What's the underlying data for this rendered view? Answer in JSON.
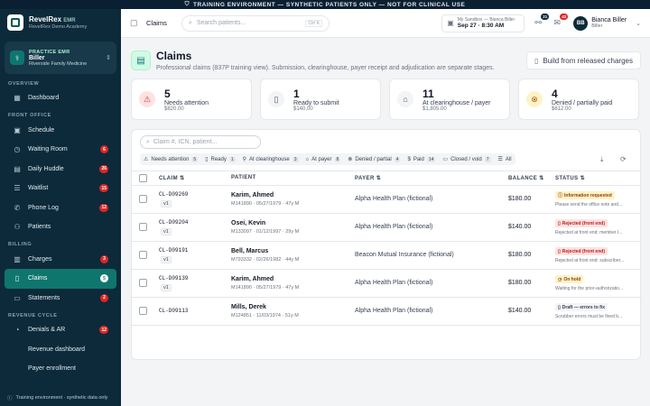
{
  "banner": {
    "icon": "shield-icon",
    "text": "TRAINING ENVIRONMENT — SYNTHETIC PATIENTS ONLY — NOT FOR CLINICAL USE"
  },
  "brand": {
    "name": "RevelRex",
    "suffix": "EMR",
    "subtitle": "RevelRex Demo Academy"
  },
  "practice": {
    "label": "PRACTICE EMR",
    "user": "Biller",
    "location": "Riverside Family Medicine"
  },
  "sidebar": {
    "sections": [
      {
        "title": "OVERVIEW",
        "items": [
          {
            "label": "Dashboard",
            "icon": "grid-icon",
            "badge": ""
          }
        ]
      },
      {
        "title": "FRONT OFFICE",
        "items": [
          {
            "label": "Schedule",
            "icon": "calendar-icon",
            "badge": ""
          },
          {
            "label": "Waiting Room",
            "icon": "clock-icon",
            "badge": "6"
          },
          {
            "label": "Daily Huddle",
            "icon": "clipboard-icon",
            "badge": "26"
          },
          {
            "label": "Waitlist",
            "icon": "list-icon",
            "badge": "15"
          },
          {
            "label": "Phone Log",
            "icon": "phone-icon",
            "badge": "12"
          },
          {
            "label": "Patients",
            "icon": "users-icon",
            "badge": ""
          }
        ]
      },
      {
        "title": "BILLING",
        "items": [
          {
            "label": "Charges",
            "icon": "receipt-icon",
            "badge": "3"
          },
          {
            "label": "Claims",
            "icon": "document-icon",
            "badge": "5",
            "active": true
          },
          {
            "label": "Statements",
            "icon": "file-icon",
            "badge": "2"
          }
        ]
      },
      {
        "title": "REVENUE CYCLE",
        "items": [
          {
            "label": "Denials & AR",
            "icon": "alert-icon",
            "badge": "12"
          },
          {
            "label": "Revenue dashboard",
            "icon": "",
            "badge": ""
          },
          {
            "label": "Payer enrollment",
            "icon": "",
            "badge": ""
          }
        ]
      }
    ],
    "footer": "Training environment · synthetic data only"
  },
  "topbar": {
    "breadcrumb": "Claims",
    "search_placeholder": "Search patients...",
    "search_shortcut": "Ctrl K",
    "sandbox_label": "My Sandbox — Bianca Biller",
    "sandbox_date": "Sep 27 · 8:30 AM",
    "tasks_count": "21",
    "messages_count": "42",
    "user_initials": "BB",
    "user_name": "Bianca Biller",
    "user_role": "Biller"
  },
  "page": {
    "title": "Claims",
    "subtitle": "Professional claims (837P training view). Submission, clearinghouse, payer receipt and adjudication are separate stages.",
    "build_button": "Build from released charges"
  },
  "stats": [
    {
      "value": "5",
      "label": "Needs attention",
      "amount": "$820.00",
      "icon": "warning-icon",
      "bg": "#fee2e2",
      "fg": "#dc2626"
    },
    {
      "value": "1",
      "label": "Ready to submit",
      "amount": "$140.00",
      "icon": "document-icon",
      "bg": "#f3f4f6",
      "fg": "#4b5563"
    },
    {
      "value": "11",
      "label": "At clearinghouse / payer",
      "amount": "$1,805.00",
      "icon": "bank-icon",
      "bg": "#f3f4f6",
      "fg": "#4b5563"
    },
    {
      "value": "4",
      "label": "Denied / partially paid",
      "amount": "$612.00",
      "icon": "x-circle-icon",
      "bg": "#fef3c7",
      "fg": "#b45309"
    }
  ],
  "claims_search_placeholder": "Claim #, ICN, patient...",
  "filters": [
    {
      "label": "Needs attention",
      "count": "5"
    },
    {
      "label": "Ready",
      "count": "1"
    },
    {
      "label": "At clearinghouse",
      "count": "3"
    },
    {
      "label": "At payer",
      "count": "8"
    },
    {
      "label": "Denied / partial",
      "count": "4"
    },
    {
      "label": "Paid",
      "count": "14"
    },
    {
      "label": "Closed / void",
      "count": "7"
    },
    {
      "label": "All",
      "count": ""
    }
  ],
  "table": {
    "headers": {
      "claim": "CLAIM",
      "patient": "PATIENT",
      "payer": "PAYER",
      "balance": "BALANCE",
      "status": "STATUS"
    },
    "rows": [
      {
        "claim": "CL-D09269",
        "version": "v1",
        "patient": "Karim, Ahmed",
        "meta": "M141890 · 05/27/1979 · 47y M",
        "payer": "Alpha Health Plan (fictional)",
        "balance": "$180.00",
        "status": "Information requested",
        "status_kind": "warn",
        "note": "Please send the office note and..."
      },
      {
        "claim": "CL-D09204",
        "version": "v1",
        "patient": "Osei, Kevin",
        "meta": "M133097 · 01/12/1997 · 29y M",
        "payer": "Alpha Health Plan (fictional)",
        "balance": "$140.00",
        "status": "Rejected (front end)",
        "status_kind": "danger",
        "note": "Rejected at front end: member I..."
      },
      {
        "claim": "CL-D09191",
        "version": "v1",
        "patient": "Bell, Marcus",
        "meta": "M793332 · 02/26/1982 · 44y M",
        "payer": "Beacon Mutual Insurance (fictional)",
        "balance": "$180.00",
        "status": "Rejected (front end)",
        "status_kind": "danger",
        "note": "Rejected at front end: subscriber..."
      },
      {
        "claim": "CL-D09139",
        "version": "v1",
        "patient": "Karim, Ahmed",
        "meta": "M141890 · 05/27/1979 · 47y M",
        "payer": "Alpha Health Plan (fictional)",
        "balance": "$180.00",
        "status": "On hold",
        "status_kind": "warn",
        "note": "Waiting for the prior-authorizatio..."
      },
      {
        "claim": "CL-D09113",
        "version": "",
        "patient": "Mills, Derek",
        "meta": "M124851 · 11/03/1974 · 51y M",
        "payer": "Alpha Health Plan (fictional)",
        "balance": "$140.00",
        "status": "Draft — errors to fix",
        "status_kind": "neutral",
        "note": "Scrubber errors must be fixed b..."
      }
    ]
  }
}
